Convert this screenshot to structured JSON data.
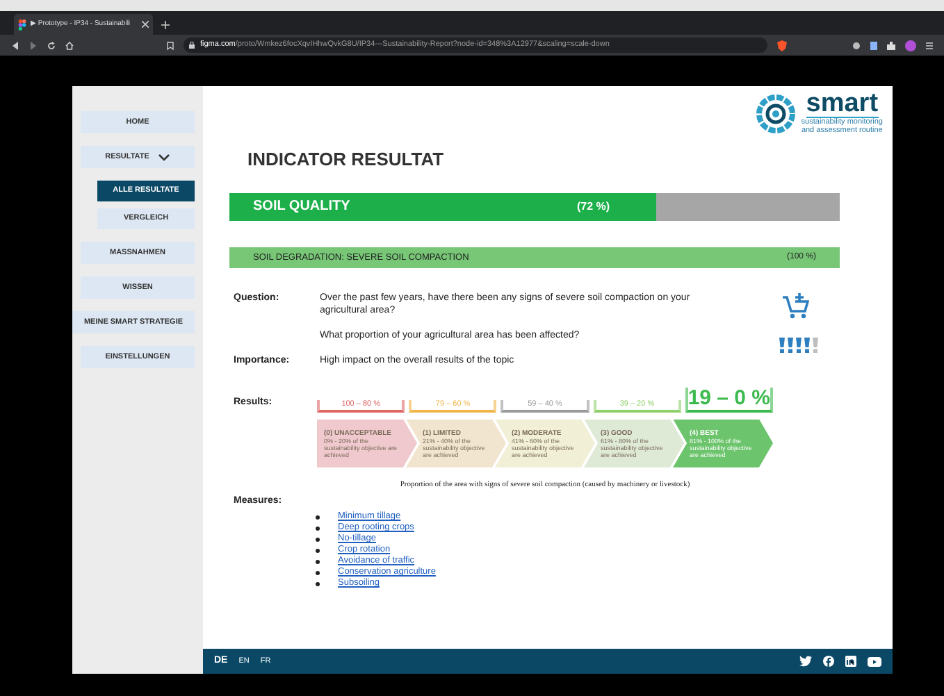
{
  "browser": {
    "tab_title": "▶ Prototype - IP34 - Sustainabili",
    "url_host": "figma.com",
    "url_path": "/proto/Wmkez6focXqvIHhwQvkG8U/IP34---Sustainability-Report?node-id=348%3A12977&scaling=scale-down"
  },
  "sidebar": {
    "items": [
      {
        "label": "HOME",
        "selected": false
      },
      {
        "label": "RESULTATE",
        "selected": false,
        "expanded": true,
        "children": [
          {
            "label": "ALLE RESULTATE",
            "selected": true
          },
          {
            "label": "VERGLEICH",
            "selected": false
          }
        ]
      },
      {
        "label": "MASSNAHMEN",
        "selected": false
      },
      {
        "label": "WISSEN",
        "selected": false
      },
      {
        "label": "MEINE SMART STRATEGIE",
        "selected": false
      },
      {
        "label": "EINSTELLUNGEN",
        "selected": false
      }
    ]
  },
  "logo": {
    "name": "smart",
    "tagline": [
      "sustainability monitoring",
      "and assessment routine"
    ]
  },
  "title": "INDICATOR RESULTAT",
  "topic": {
    "label": "SOIL QUALITY",
    "percent": "(72 %)",
    "level": 0.7
  },
  "indicator": {
    "label": "SOIL DEGRADATION: SEVERE SOIL COMPACTION",
    "percent": "(100 %)"
  },
  "question": {
    "label": "Question:",
    "texts": [
      "Over the past few years, have there been any signs of severe soil compaction on your agricultural area?",
      "What proportion of your agricultural area has been affected?"
    ]
  },
  "importance": {
    "label": "Importance:",
    "text": "High impact on the overall results of the topic",
    "rating": [
      {
        "filled": true
      },
      {
        "filled": true
      },
      {
        "filled": true
      },
      {
        "filled": true
      },
      {
        "filled": false
      }
    ]
  },
  "results": {
    "label": "Results:",
    "ranges": [
      {
        "label": "100 – 80 %",
        "color": "#e06666",
        "selected": false
      },
      {
        "label": "79 – 60 %",
        "color": "#f0b64a",
        "selected": false
      },
      {
        "label": "59 – 40 %",
        "color": "#9a9a9a",
        "selected": false
      },
      {
        "label": "39 – 20 %",
        "color": "#8fcf6a",
        "selected": false
      },
      {
        "label": "19 – 0 %",
        "color": "#3dba4e",
        "selected": true
      }
    ],
    "levels": [
      {
        "title": "(0) UNACCEPTABLE",
        "description": "0% - 20% of the sustainability objective are achieved",
        "color": "#efc9cd",
        "selected": false
      },
      {
        "title": "(1) LIMITED",
        "description": "21% - 40% of the sustainability objective are achieved",
        "color": "#f2e5cf",
        "selected": false
      },
      {
        "title": "(2) MODERATE",
        "description": "41% - 60% of the sustainability objective are achieved",
        "color": "#f1efd6",
        "selected": false
      },
      {
        "title": "(3) GOOD",
        "description": "61% - 80% of the sustainability objective are achieved",
        "color": "#dfead6",
        "selected": false
      },
      {
        "title": "(4) BEST",
        "description": "81% - 100% of the sustainability objective are achieved",
        "color": "#6cc46c",
        "selected": true
      }
    ],
    "caption": "Proportion of the area with signs of severe soil compaction (caused by machinery or livestock)"
  },
  "measures": {
    "label": "Measures:",
    "items": [
      "Minimum tillage",
      "Deep rooting crops",
      "No-tillage",
      "Crop rotation",
      "Avoidance of traffic",
      "Conservation agriculture",
      "Subsoiling"
    ]
  },
  "footer": {
    "languages": [
      {
        "label": "DE",
        "selected": true
      },
      {
        "label": "EN",
        "selected": false
      },
      {
        "label": "FR",
        "selected": false
      }
    ]
  }
}
